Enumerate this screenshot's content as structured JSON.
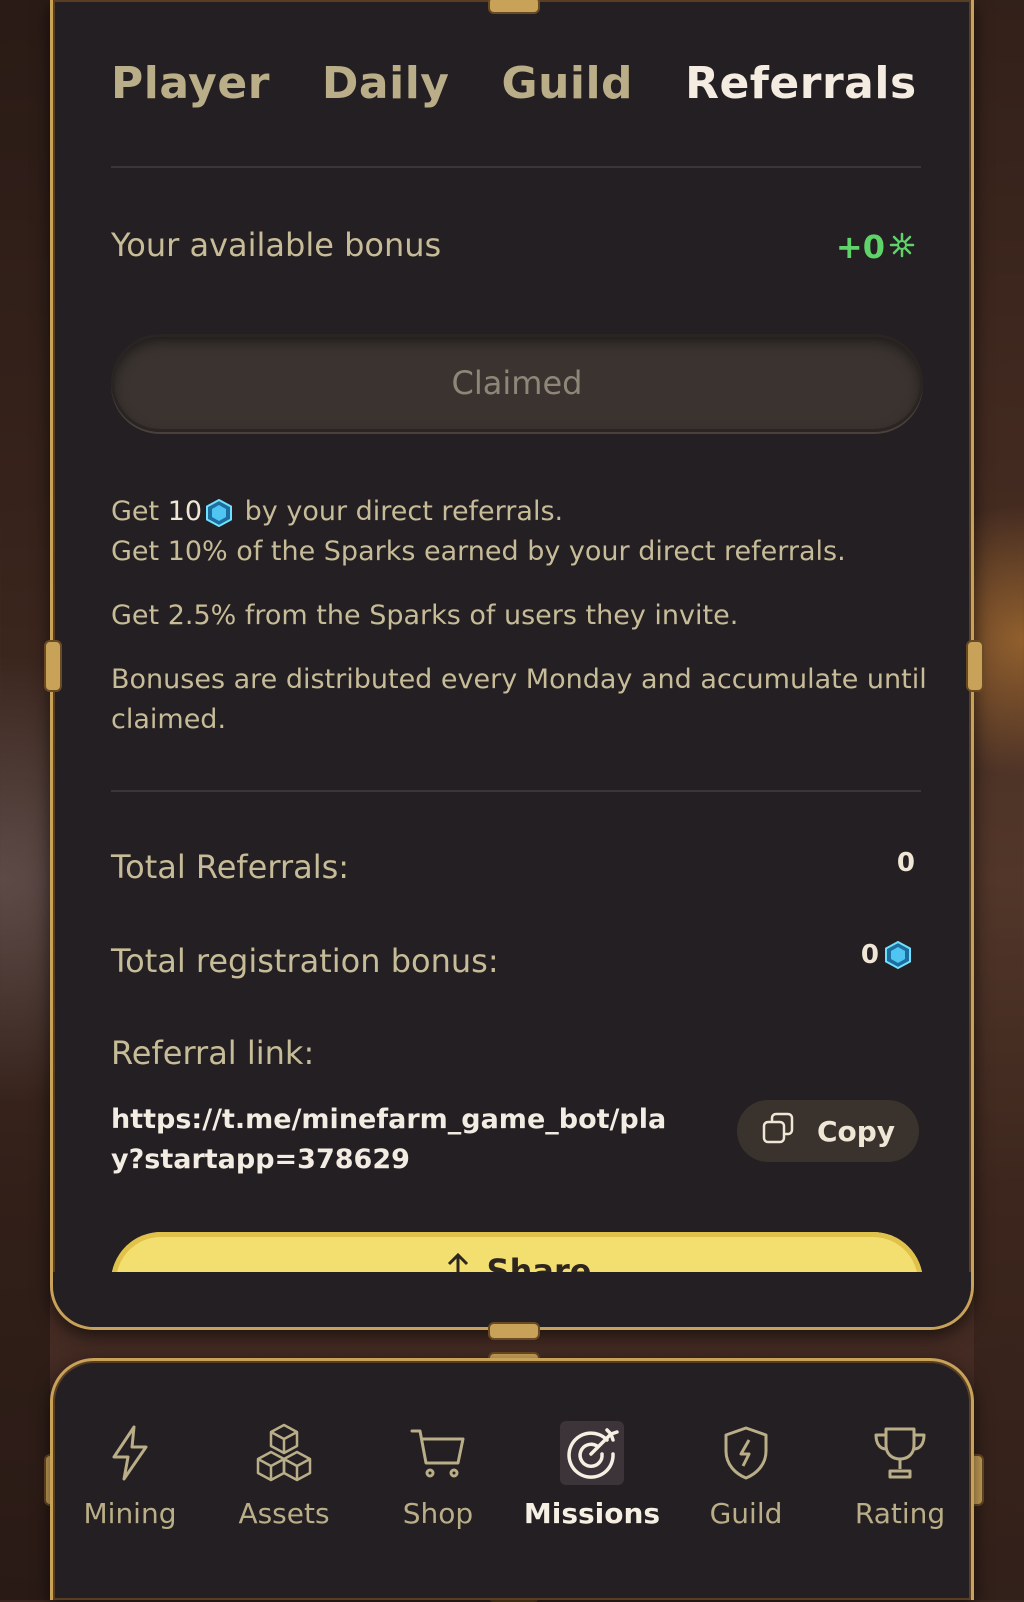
{
  "tabs": [
    {
      "label": "Player",
      "active": false
    },
    {
      "label": "Daily",
      "active": false
    },
    {
      "label": "Guild",
      "active": false
    },
    {
      "label": "Referrals",
      "active": true
    }
  ],
  "bonus": {
    "label": "Your available bonus",
    "value": "+0",
    "value_icon": "spark-icon",
    "value_color": "#5fd36a"
  },
  "claim_button": {
    "label": "Claimed"
  },
  "info": {
    "line1_prefix": "Get",
    "line1_amount": "10",
    "line1_icon": "gem-icon",
    "line1_suffix": "by your direct referrals.",
    "line2": "Get 10% of the Sparks earned by your direct referrals.",
    "line3": "Get 2.5% from the Sparks of users they invite.",
    "line4": "Bonuses are distributed every Monday and accumulate until claimed."
  },
  "stats": {
    "total_referrals_label": "Total Referrals:",
    "total_referrals_value": "0",
    "registration_bonus_label": "Total registration bonus:",
    "registration_bonus_value": "0",
    "referral_link_label": "Referral link:",
    "referral_link": "https://t.me/minefarm_game_bot/play?startapp=378629"
  },
  "copy_button": {
    "label": "Copy",
    "icon": "copy-icon"
  },
  "share_button": {
    "label": "Share",
    "icon": "share-icon"
  },
  "bottom_nav": [
    {
      "label": "Mining",
      "icon": "lightning-icon",
      "active": false
    },
    {
      "label": "Assets",
      "icon": "cubes-icon",
      "active": false
    },
    {
      "label": "Shop",
      "icon": "cart-icon",
      "active": false
    },
    {
      "label": "Missions",
      "icon": "target-icon",
      "active": true
    },
    {
      "label": "Guild",
      "icon": "shield-icon",
      "active": false
    },
    {
      "label": "Rating",
      "icon": "trophy-icon",
      "active": false
    }
  ],
  "colors": {
    "accent_gold": "#c9a25a",
    "panel_bg": "#241f22",
    "text_muted": "#c7bc98",
    "share_yellow": "#f3df6f"
  }
}
